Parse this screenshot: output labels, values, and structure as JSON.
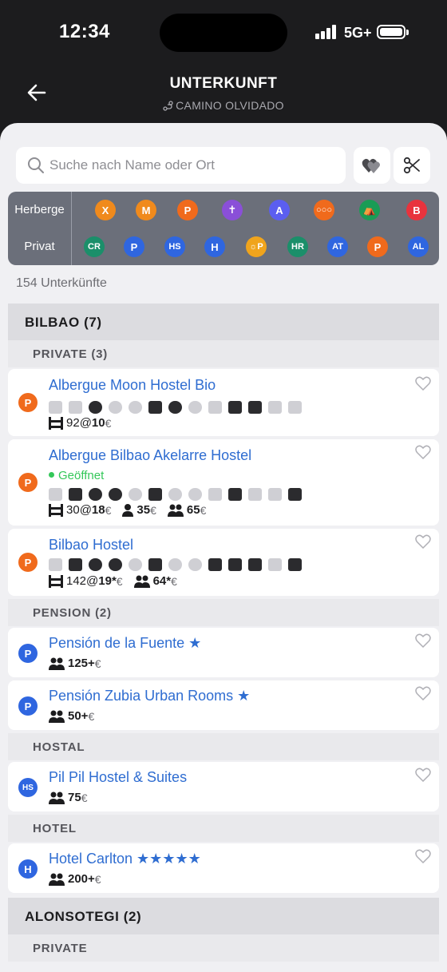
{
  "status": {
    "time": "12:34",
    "network": "5G+"
  },
  "header": {
    "title": "UNTERKUNFT",
    "subtitle": "CAMINO OLVIDADO"
  },
  "search": {
    "placeholder": "Suche nach Name oder Ort"
  },
  "filters": {
    "row1": {
      "label": "Herberge",
      "badges": [
        {
          "text": "X",
          "color": "#f08a1c"
        },
        {
          "text": "M",
          "color": "#f08a1c"
        },
        {
          "text": "P",
          "color": "#f06a1c"
        },
        {
          "text": "✝",
          "color": "#8a4fd8"
        },
        {
          "text": "A",
          "color": "#5b5ef0"
        },
        {
          "text": "○○○",
          "color": "#f06a1c"
        },
        {
          "text": "⛺",
          "color": "#1a9c55"
        },
        {
          "text": "B",
          "color": "#e8333d"
        }
      ]
    },
    "row2": {
      "label": "Privat",
      "badges": [
        {
          "text": "CR",
          "color": "#1b8f6a"
        },
        {
          "text": "P",
          "color": "#2f66e0"
        },
        {
          "text": "HS",
          "color": "#2f66e0"
        },
        {
          "text": "H",
          "color": "#2f66e0"
        },
        {
          "text": "☼P",
          "color": "#f0a41c"
        },
        {
          "text": "HR",
          "color": "#1b8f6a"
        },
        {
          "text": "AT",
          "color": "#2f66e0"
        },
        {
          "text": "P",
          "color": "#f06a1c"
        },
        {
          "text": "AL",
          "color": "#2f66e0"
        }
      ]
    }
  },
  "count_label": "154 Unterkünfte",
  "colors": {
    "private": "#f06a1c",
    "pension": "#2f66e0",
    "link": "#2f6dd1",
    "open": "#34c759"
  },
  "sections": {
    "bilbao": {
      "title": "BILBAO (7)",
      "private_title": "PRIVATE (3)",
      "items": [
        {
          "badge": "P",
          "name": "Albergue Moon Hostel Bio",
          "beds": "92",
          "bed_price": "10",
          "currency": "€"
        },
        {
          "badge": "P",
          "name": "Albergue Bilbao Akelarre Hostel",
          "status": "Geöffnet",
          "beds": "30",
          "bed_price": "18",
          "single": "35",
          "double": "65",
          "currency": "€"
        },
        {
          "badge": "P",
          "name": "Bilbao Hostel",
          "beds": "142",
          "bed_price": "19*",
          "double": "64*",
          "currency": "€"
        }
      ],
      "pension_title": "PENSION (2)",
      "pensions": [
        {
          "badge": "P",
          "name": "Pensión de la Fuente ★",
          "double": "125+",
          "currency": "€"
        },
        {
          "badge": "P",
          "name": "Pensión Zubia Urban Rooms ★",
          "double": "50+",
          "currency": "€"
        }
      ],
      "hostal_title": "HOSTAL",
      "hostal": {
        "badge": "HS",
        "name": "Pil Pil Hostel & Suites",
        "double": "75",
        "currency": "€"
      },
      "hotel_title": "HOTEL",
      "hotel": {
        "badge": "H",
        "name": "Hotel Carlton ★★★★★",
        "double": "200+",
        "currency": "€"
      }
    },
    "alonsotegi": {
      "title": "ALONSOTEGI (2)",
      "private_title": "PRIVATE"
    }
  }
}
